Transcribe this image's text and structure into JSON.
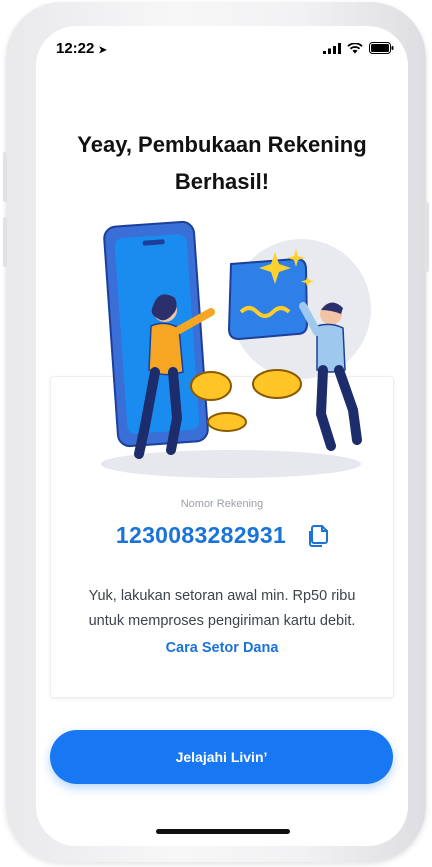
{
  "status_bar": {
    "time": "12:22"
  },
  "page": {
    "title_line1": "Yeay, Pembukaan Rekening",
    "title_line2": "Berhasil!"
  },
  "account": {
    "label": "Nomor Rekening",
    "number": "1230083282931"
  },
  "info": {
    "line1": "Yuk, lakukan setoran awal min. Rp50 ribu",
    "line2": "untuk memproses pengiriman kartu debit.",
    "link": "Cara Setor Dana"
  },
  "cta": {
    "label": "Jelajahi Livin’"
  },
  "colors": {
    "accent": "#1877f2",
    "link": "#1a73d9"
  }
}
